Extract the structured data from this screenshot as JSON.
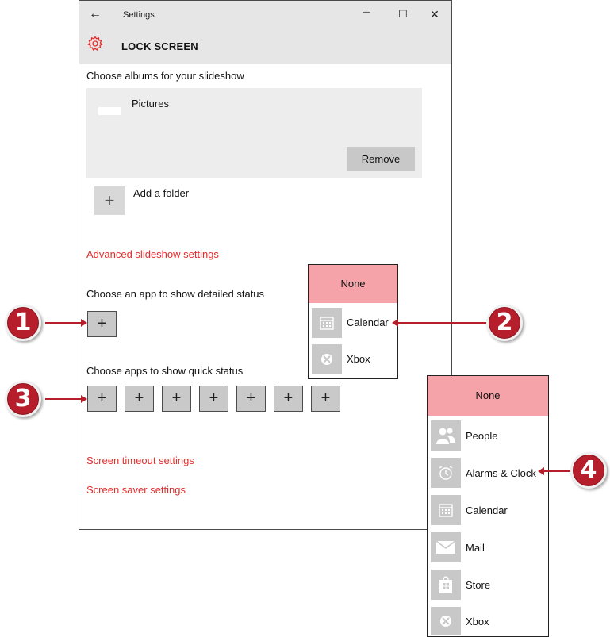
{
  "window": {
    "title": "Settings",
    "back_icon": "←",
    "minimize_icon": "—",
    "maximize_icon": "☐",
    "close_icon": "✕",
    "page_title": "LOCK SCREEN",
    "accent": "#e52d2d"
  },
  "slideshow": {
    "heading": "Choose albums for your slideshow",
    "album": "Pictures",
    "remove_label": "Remove",
    "add_folder_label": "Add a folder",
    "plus": "+"
  },
  "links": {
    "advanced_slideshow": "Advanced slideshow settings",
    "screen_timeout": "Screen timeout settings",
    "screen_saver": "Screen saver settings"
  },
  "detailed_status": {
    "heading": "Choose an app to show detailed status",
    "plus": "+"
  },
  "quick_status": {
    "heading": "Choose apps to show quick status",
    "slots": [
      "+",
      "+",
      "+",
      "+",
      "+",
      "+",
      "+"
    ]
  },
  "popup_detailed": {
    "none_label": "None",
    "items": [
      {
        "label": "Calendar",
        "icon": "calendar-icon"
      },
      {
        "label": "Xbox",
        "icon": "xbox-icon"
      }
    ]
  },
  "popup_quick": {
    "none_label": "None",
    "items": [
      {
        "label": "People",
        "icon": "people-icon"
      },
      {
        "label": "Alarms & Clock",
        "icon": "alarm-clock-icon"
      },
      {
        "label": "Calendar",
        "icon": "calendar-icon"
      },
      {
        "label": "Mail",
        "icon": "mail-icon"
      },
      {
        "label": "Store",
        "icon": "store-icon"
      },
      {
        "label": "Xbox",
        "icon": "xbox-icon"
      }
    ]
  },
  "callouts": [
    "1",
    "2",
    "3",
    "4"
  ]
}
